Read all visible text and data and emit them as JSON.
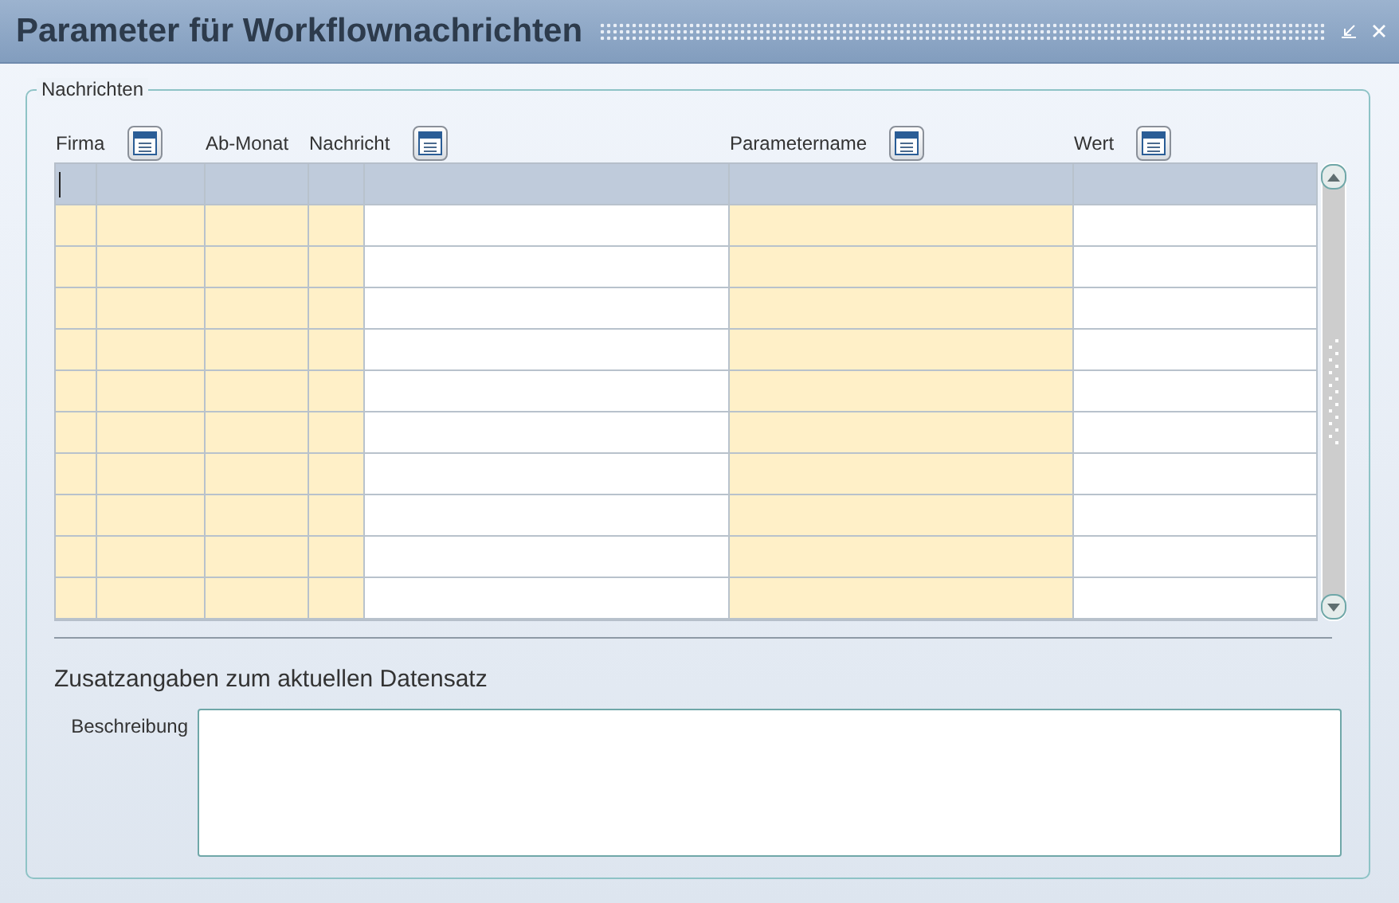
{
  "window": {
    "title": "Parameter für Workflownachrichten"
  },
  "group": {
    "legend": "Nachrichten",
    "columns": [
      {
        "label": "Firma",
        "picker": true
      },
      {
        "label": "Ab-Monat",
        "picker": false
      },
      {
        "label": "Nachricht",
        "picker": true
      },
      {
        "label": "Parametername",
        "picker": true
      },
      {
        "label": "Wert",
        "picker": true
      }
    ],
    "grid_columns": [
      {
        "highlighted": true
      },
      {
        "highlighted": true
      },
      {
        "highlighted": true
      },
      {
        "highlighted": true
      },
      {
        "highlighted": false
      },
      {
        "highlighted": true
      },
      {
        "highlighted": false
      }
    ],
    "rows": [
      {
        "selected": true
      },
      {
        "selected": false
      },
      {
        "selected": false
      },
      {
        "selected": false
      },
      {
        "selected": false
      },
      {
        "selected": false
      },
      {
        "selected": false
      },
      {
        "selected": false
      },
      {
        "selected": false
      },
      {
        "selected": false
      },
      {
        "selected": false
      }
    ],
    "details_heading": "Zusatzangaben zum aktuellen Datensatz",
    "description": {
      "label": "Beschreibung"
    }
  }
}
